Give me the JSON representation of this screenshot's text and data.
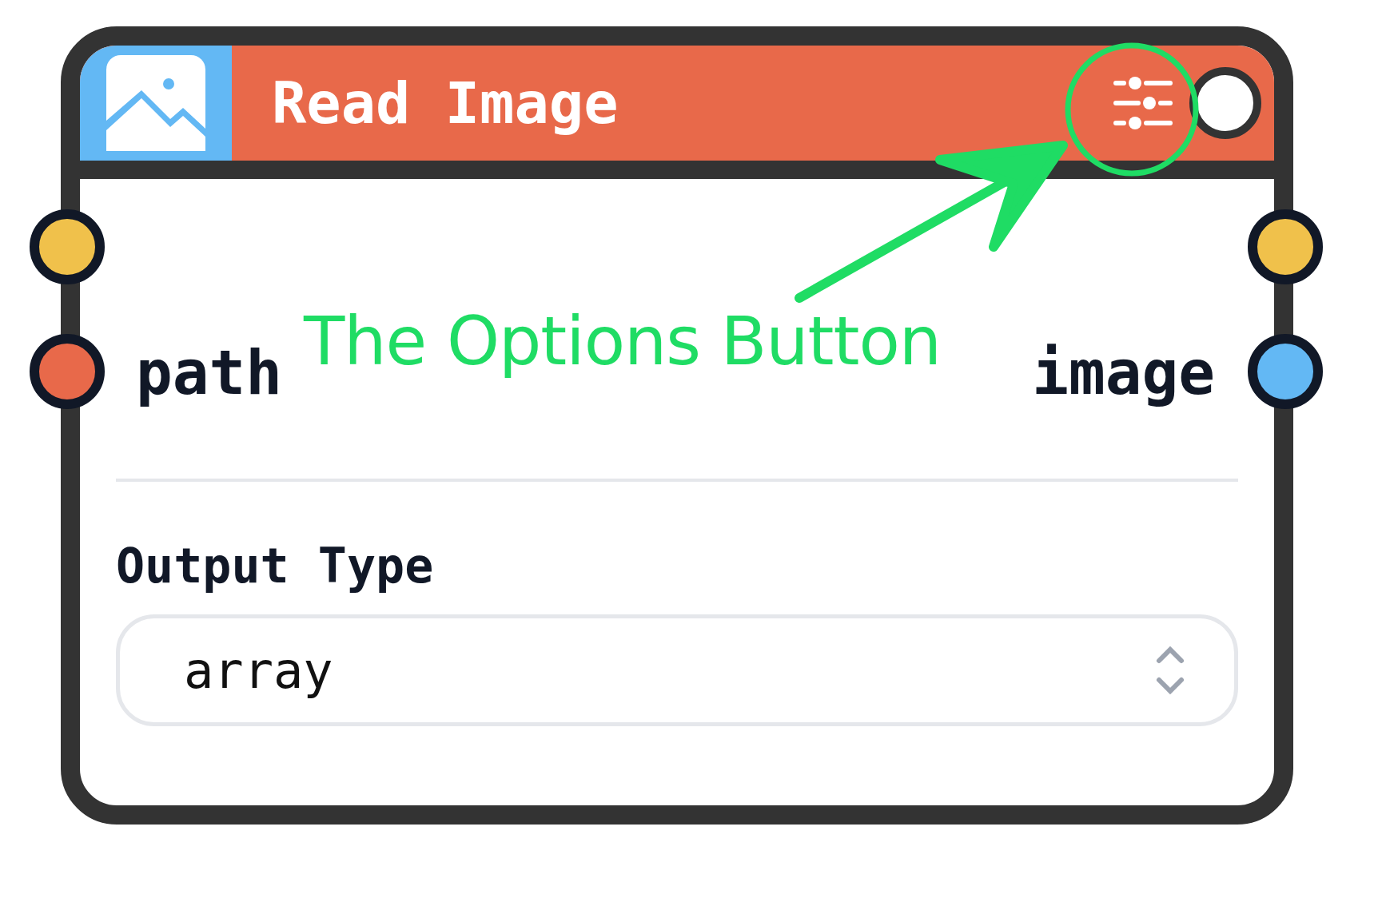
{
  "node": {
    "title": "Read Image",
    "inputs": [
      {
        "color": "#f0c14b"
      },
      {
        "label": "path",
        "color": "#e8694a"
      }
    ],
    "outputs": [
      {
        "color": "#f0c14b"
      },
      {
        "label": "image",
        "color": "#63b8f4"
      }
    ],
    "field": {
      "label": "Output Type",
      "value": "array"
    }
  },
  "annotation": {
    "text": "The Options Button"
  }
}
